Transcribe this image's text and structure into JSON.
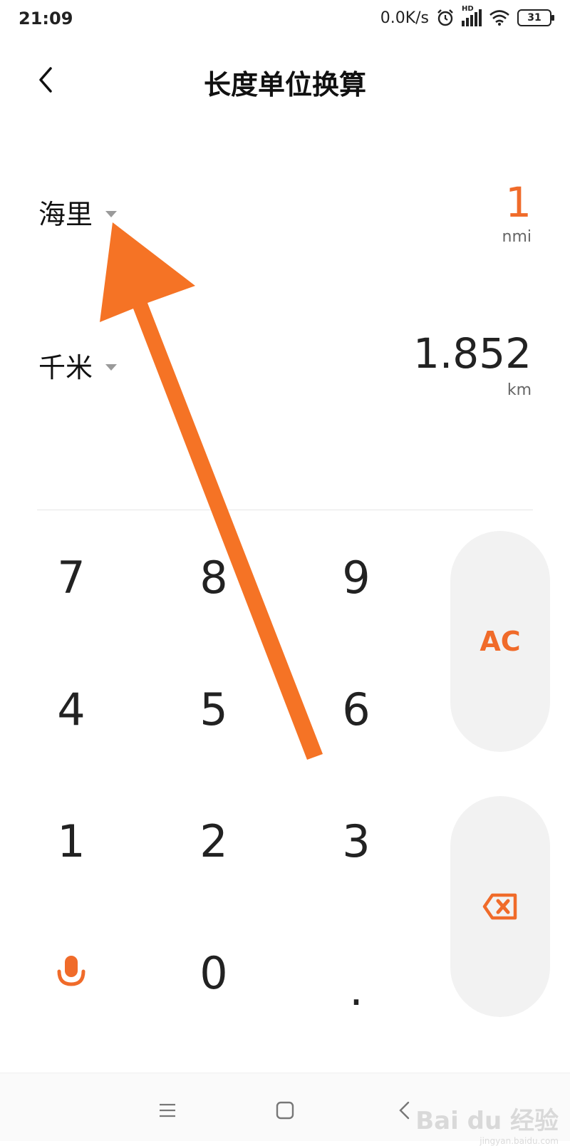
{
  "status_bar": {
    "time": "21:09",
    "network_speed": "0.0K/s",
    "network_type": "HD",
    "battery": "31",
    "icons": [
      "alarm-icon",
      "signal-icon",
      "wifi-icon",
      "battery-icon"
    ]
  },
  "header": {
    "title": "长度单位换算",
    "back_icon": "chevron-left-icon"
  },
  "conversion": {
    "from": {
      "unit_name": "海里",
      "value": "1",
      "unit_abbr": "nmi",
      "value_color": "#f06b2a"
    },
    "to": {
      "unit_name": "千米",
      "value": "1.852",
      "unit_abbr": "km",
      "value_color": "#222222"
    }
  },
  "keypad": {
    "keys": [
      "7",
      "8",
      "9",
      "4",
      "5",
      "6",
      "1",
      "2",
      "3",
      "",
      "0",
      "."
    ],
    "mic_icon": "microphone-icon",
    "clear_label": "AC",
    "backspace_icon": "backspace-icon",
    "accent_color": "#f06b2a"
  },
  "nav_bar": {
    "buttons": [
      "menu-icon",
      "home-icon",
      "back-icon"
    ]
  },
  "annotation": {
    "arrow_color": "#f57325"
  },
  "watermark": {
    "logo": "Bai du 经验",
    "url": "jingyan.baidu.com"
  }
}
